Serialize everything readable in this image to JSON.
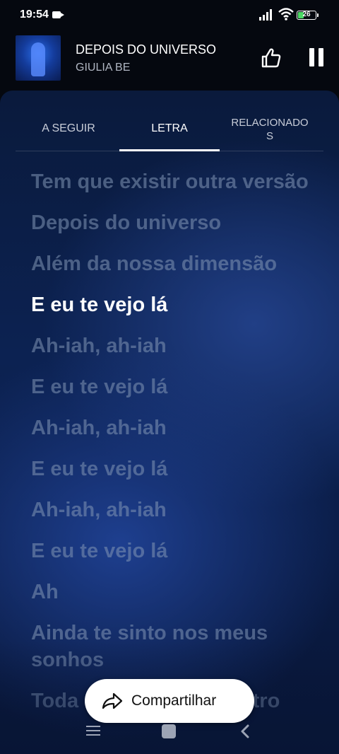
{
  "status": {
    "time": "19:54",
    "battery": "26"
  },
  "player": {
    "title": "DEPOIS DO UNIVERSO",
    "artist": "GIULIA BE"
  },
  "tabs": [
    {
      "label": "A SEGUIR"
    },
    {
      "label": "LETRA"
    },
    {
      "label": "RELACIONADO\nS"
    }
  ],
  "lyrics": [
    "Tem que existir outra versão",
    "Depois do universo",
    "Além da nossa dimensão",
    "E eu te vejo lá",
    "Ah-iah, ah-iah",
    "E eu te vejo lá",
    "Ah-iah, ah-iah",
    "E eu te vejo lá",
    "Ah-iah, ah-iah",
    "E eu te vejo lá",
    "Ah",
    "Ainda te sinto nos meus sonhos",
    "Toda noite eu te encontro"
  ],
  "share": {
    "label": "Compartilhar"
  },
  "colors": {
    "accent": "#ffffff",
    "panel": "#0c2252",
    "inactive_lyric": "#8296b4"
  },
  "icons": [
    "thumbs-up-icon",
    "pause-icon",
    "share-icon",
    "menu-icon",
    "home-icon",
    "back-icon"
  ]
}
